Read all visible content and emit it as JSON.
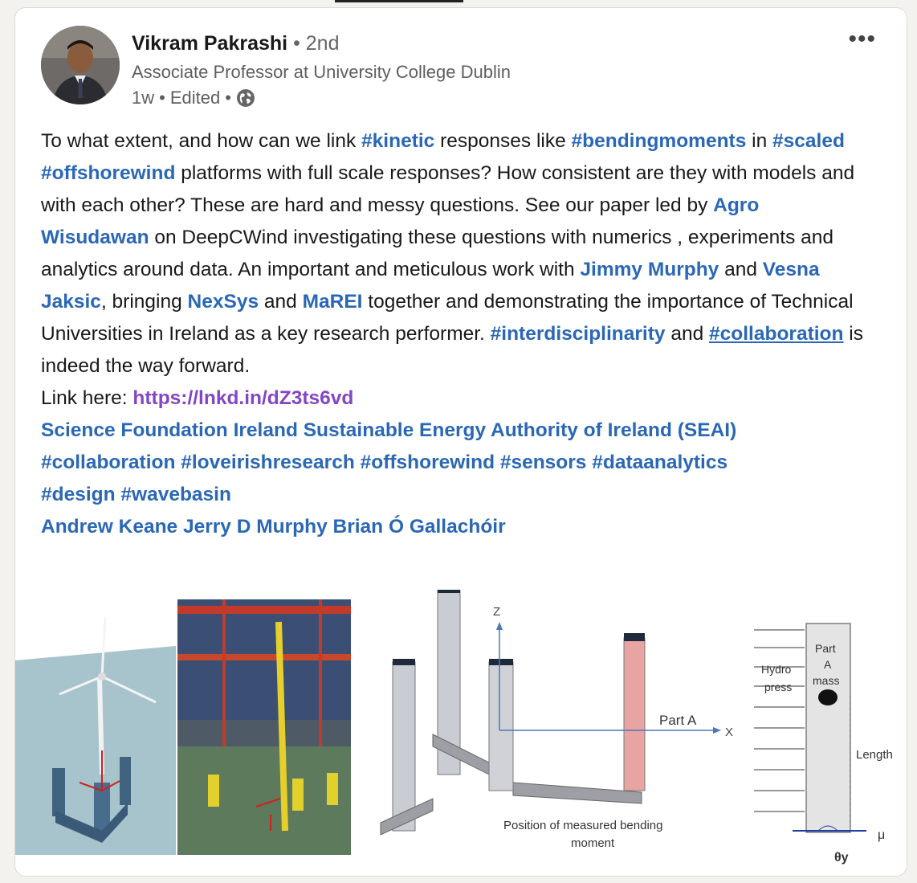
{
  "author": {
    "name": "Vikram Pakrashi",
    "degree": "• 2nd",
    "headline": "Associate Professor at University College Dublin",
    "time": "1w",
    "edited": "Edited"
  },
  "post": {
    "p1": "To what extent, and how can we link ",
    "t_kinetic": "#kinetic",
    "p2": " responses like ",
    "t_bending": "#bendingmoments",
    "p3": " in ",
    "t_scaled": "#scaled",
    "p4": " ",
    "t_offshore": "#offshorewind",
    "p5": " platforms with full scale responses? How consistent are they with models and with each other? These are hard and messy questions. See our paper led by ",
    "m_agro": "Agro Wisudawan",
    "p6": " on DeepCWind investigating these questions with numerics , experiments and analytics around data. An important and meticulous work with ",
    "m_jimmy": "Jimmy Murphy",
    "p7": " and ",
    "m_vesna": "Vesna Jaksic",
    "p8": ", bringing ",
    "m_nexsys": "NexSys",
    "p9": " and ",
    "m_marei": "MaREI",
    "p10": " together and demonstrating the importance of Technical Universities in Ireland as a key research performer. ",
    "t_interdisc": "#interdisciplinarity",
    "p11": " and ",
    "t_collab": "#collaboration",
    "p12": " is indeed the way forward.",
    "link_label": "Link here: ",
    "link_url": "https://lnkd.in/dZ3ts6vd",
    "orgs_line": "Science Foundation Ireland Sustainable Energy Authority of Ireland (SEAI)",
    "tags_line1": "#collaboration #loveirishresearch #offshorewind #sensors #dataanalytics",
    "tags_line2": "#design #wavebasin",
    "people_line": "Andrew Keane Jerry D Murphy Brian Ó Gallachóir"
  },
  "figure": {
    "z_label": "Z",
    "x_label": "X",
    "part_a": "Part A",
    "pos_line1": "Position of measured bending",
    "pos_line2": "moment",
    "part_a_mass_1": "Part",
    "part_a_mass_2": "A",
    "part_a_mass_3": "mass",
    "hydro": "Hydro",
    "press": "press",
    "length": "Length",
    "mu": "μ",
    "theta": "θy"
  }
}
